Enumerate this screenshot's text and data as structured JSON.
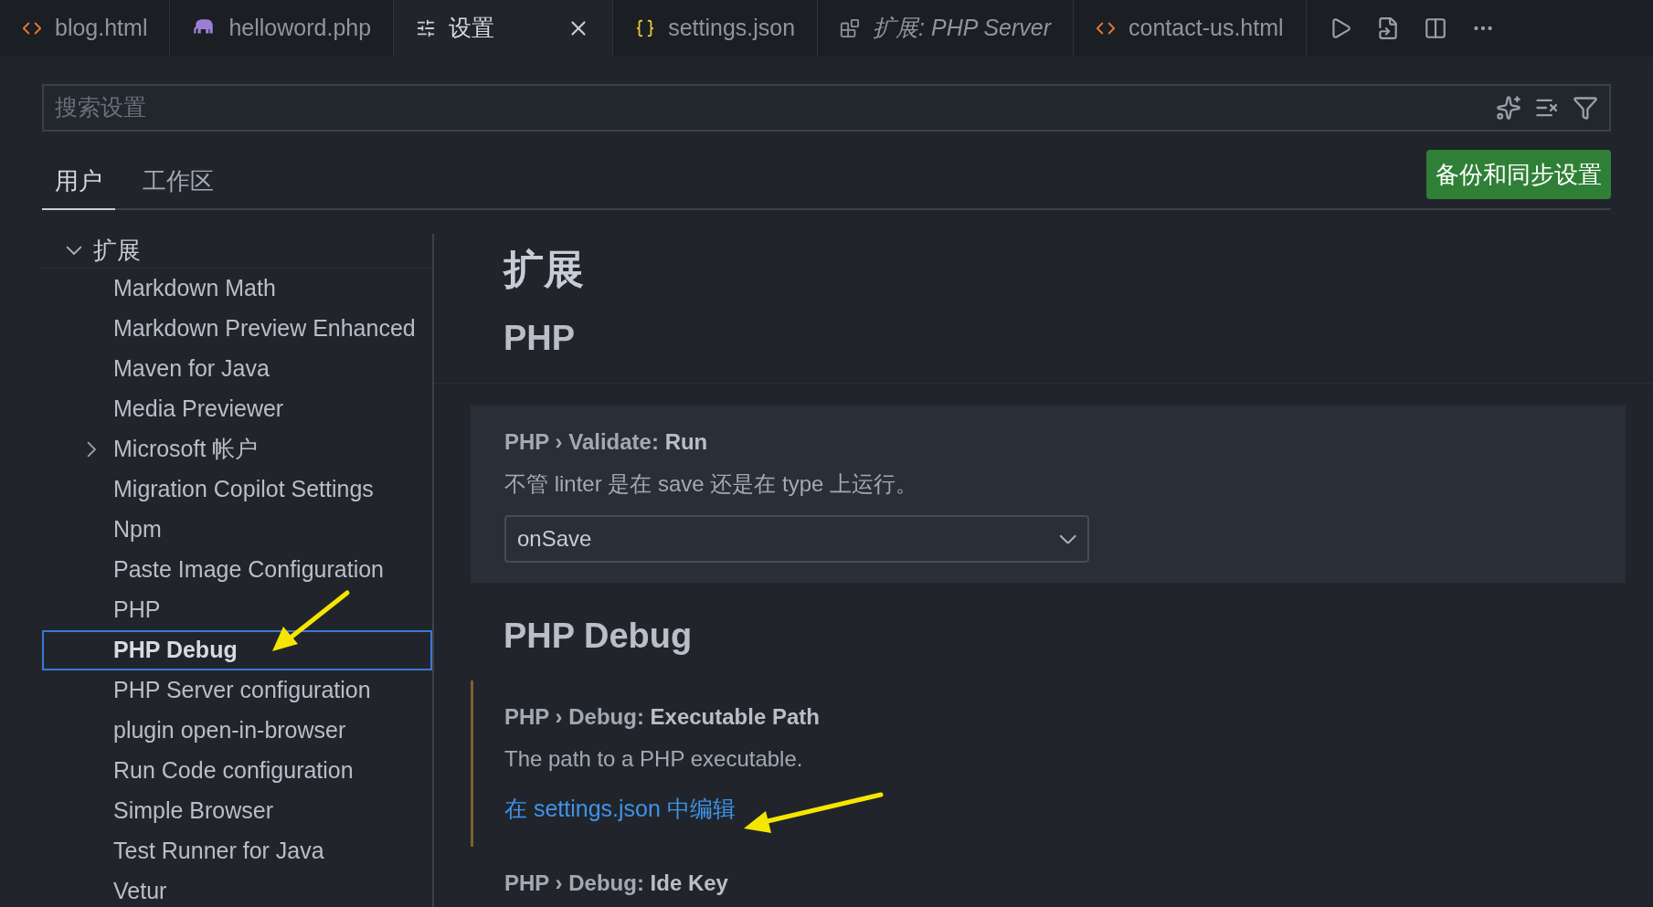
{
  "tabs": [
    {
      "label": "blog.html",
      "kind": "html",
      "italic": false,
      "selected": false
    },
    {
      "label": "helloword.php",
      "kind": "php",
      "italic": false,
      "selected": false
    },
    {
      "label": "设置",
      "kind": "settings",
      "italic": false,
      "selected": true
    },
    {
      "label": "settings.json",
      "kind": "json",
      "italic": false,
      "selected": false
    },
    {
      "label": "扩展: PHP Server",
      "kind": "extension",
      "italic": true,
      "selected": false
    },
    {
      "label": "contact-us.html",
      "kind": "html",
      "italic": false,
      "selected": false
    }
  ],
  "search": {
    "placeholder": "搜索设置"
  },
  "scope_tabs": [
    {
      "label": "用户",
      "selected": true
    },
    {
      "label": "工作区",
      "selected": false
    }
  ],
  "sync_button": "备份和同步设置",
  "tree": {
    "label": "扩展",
    "expanded": true,
    "children": [
      {
        "label": "Markdown Math",
        "selected": false
      },
      {
        "label": "Markdown Preview Enhanced",
        "selected": false
      },
      {
        "label": "Maven for Java",
        "selected": false
      },
      {
        "label": "Media Previewer",
        "selected": false
      },
      {
        "label": "Microsoft 帐户",
        "selected": false,
        "expanded": false
      },
      {
        "label": "Migration Copilot Settings",
        "selected": false
      },
      {
        "label": "Npm",
        "selected": false
      },
      {
        "label": "Paste Image Configuration",
        "selected": false
      },
      {
        "label": "PHP",
        "selected": false
      },
      {
        "label": "PHP Debug",
        "selected": true
      },
      {
        "label": "PHP Server configuration",
        "selected": false
      },
      {
        "label": "plugin open-in-browser",
        "selected": false
      },
      {
        "label": "Run Code configuration",
        "selected": false
      },
      {
        "label": "Simple Browser",
        "selected": false
      },
      {
        "label": "Test Runner for Java",
        "selected": false
      },
      {
        "label": "Vetur",
        "selected": false
      }
    ]
  },
  "content": {
    "heading": "扩展",
    "sections": [
      {
        "title": "PHP",
        "settings": [
          {
            "kind": "dropdown",
            "category": "PHP › Validate: ",
            "name": "Run",
            "description": "不管 linter 是在 save 还是在 type 上运行。",
            "value": "onSave",
            "hovered": true,
            "modified": false
          }
        ]
      },
      {
        "title": "PHP Debug",
        "settings": [
          {
            "kind": "link",
            "category": "PHP › Debug: ",
            "name": "Executable Path",
            "description": "The path to a PHP executable.",
            "link": "在 settings.json 中编辑",
            "hovered": false,
            "modified": true
          },
          {
            "kind": "title_only",
            "category": "PHP › Debug: ",
            "name": "Ide Key",
            "hovered": false,
            "modified": false
          }
        ]
      }
    ]
  }
}
